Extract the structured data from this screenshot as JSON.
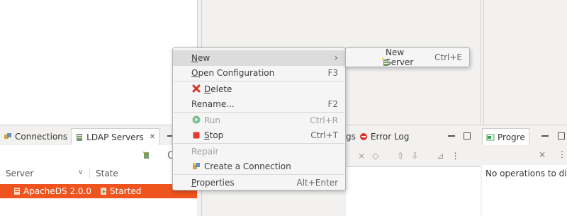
{
  "left_tabs": {
    "connections": "Connections",
    "ldap_servers": "LDAP Servers"
  },
  "servers_table": {
    "headers": [
      "Server",
      "State"
    ],
    "rows": [
      {
        "server": "ApacheDS 2.0.0",
        "state": "Started"
      }
    ]
  },
  "middle_tabs": {
    "logs_partial": "gs",
    "error_log": "Error Log"
  },
  "right_tabs": {
    "progress_partial": "Progre"
  },
  "right_panel": {
    "message": "No operations to dis"
  },
  "partial_glyph": "C",
  "context_menu": {
    "items": [
      {
        "label": "New",
        "mnemonic": "N",
        "rest": "ew",
        "arrow": "›",
        "highlighted": true
      },
      {
        "label": "Open Configuration",
        "mnemonic": "O",
        "rest": "pen Configuration",
        "shortcut": "F3"
      },
      {
        "label": "Delete",
        "mnemonic": "D",
        "rest": "elete",
        "icon": "red-x-icon"
      },
      {
        "label": "Rename...",
        "shortcut": "F2"
      },
      {
        "label": "Run",
        "shortcut": "Ctrl+R",
        "disabled": true,
        "icon": "run-icon"
      },
      {
        "label": "Stop",
        "mnemonic": "S",
        "rest": "top",
        "shortcut": "Ctrl+T",
        "icon": "stop-icon"
      },
      {
        "label": "Repair",
        "disabled": true
      },
      {
        "label": "Create a Connection",
        "icon": "connection-icon"
      },
      {
        "label": "Properties",
        "mnemonic": "P",
        "rest": "roperties",
        "shortcut": "Alt+Enter"
      }
    ]
  },
  "submenu": {
    "label": "New Server",
    "shortcut": "Ctrl+E",
    "icon": "new-server-icon"
  },
  "colors": {
    "selection": "#f0541e",
    "menu_highlight": "#dcdcdc",
    "stop_red": "#e53935",
    "run_green": "#3aa655"
  }
}
